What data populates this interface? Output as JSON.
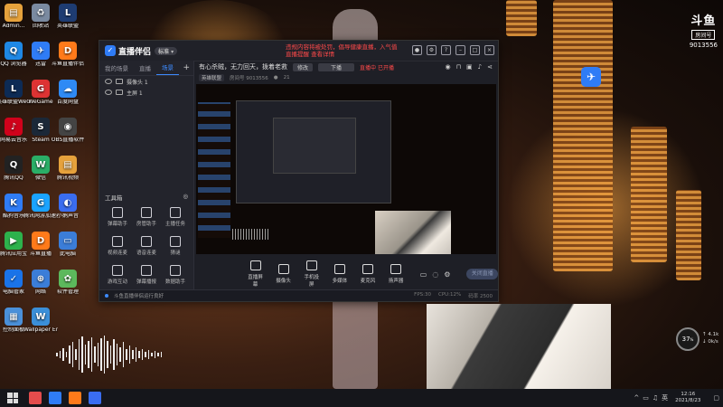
{
  "desktop_icons": [
    {
      "label": "Admin...",
      "name": "desktop-icon-admin",
      "icon": "folder-icon",
      "color": "#e6a23c",
      "glyph": "▤"
    },
    {
      "label": "回收站",
      "name": "desktop-icon-recycle-bin",
      "icon": "recycle-bin-icon",
      "color": "#7a8aa0",
      "glyph": "♻"
    },
    {
      "label": "英雄联盟",
      "name": "desktop-icon-lol",
      "icon": "game-icon",
      "color": "#1e3c72",
      "glyph": "L"
    },
    {
      "label": "QQ 浏览器",
      "name": "desktop-icon-qq-browser",
      "icon": "browser-icon",
      "color": "#1e88e5",
      "glyph": "Q"
    },
    {
      "label": "迅雷",
      "name": "desktop-icon-xunlei",
      "icon": "thunder-icon",
      "color": "#2f7cf6",
      "glyph": "✈"
    },
    {
      "label": "斗鱼直播伴侣",
      "name": "desktop-icon-douyu-assistant",
      "icon": "douyu-icon",
      "color": "#ff7a1a",
      "glyph": "D"
    },
    {
      "label": "英雄联盟WeGame版",
      "name": "desktop-icon-lol-wegame",
      "icon": "game-icon",
      "color": "#0d2b55",
      "glyph": "L"
    },
    {
      "label": "WeGame",
      "name": "desktop-icon-wegame",
      "icon": "wegame-icon",
      "color": "#d33",
      "glyph": "G"
    },
    {
      "label": "百度网盘",
      "name": "desktop-icon-baidu-pan",
      "icon": "cloud-icon",
      "color": "#2f8af5",
      "glyph": "☁"
    },
    {
      "label": "网易云音乐",
      "name": "desktop-icon-netease-music",
      "icon": "music-icon",
      "color": "#d0021b",
      "glyph": "♪"
    },
    {
      "label": "Steam",
      "name": "desktop-icon-steam",
      "icon": "steam-icon",
      "color": "#1b2838",
      "glyph": "S"
    },
    {
      "label": "OBS直播软件",
      "name": "desktop-icon-obs",
      "icon": "obs-icon",
      "color": "#444",
      "glyph": "◉"
    },
    {
      "label": "腾讯QQ",
      "name": "desktop-icon-qq",
      "icon": "qq-icon",
      "color": "#222",
      "glyph": "Q"
    },
    {
      "label": "微信",
      "name": "desktop-icon-wechat",
      "icon": "wechat-icon",
      "color": "#2aae67",
      "glyph": "W"
    },
    {
      "label": "腾讯视频",
      "name": "desktop-icon-tencent-video",
      "icon": "folder-icon",
      "color": "#e6a23c",
      "glyph": "▤"
    },
    {
      "label": "酷狗音乐",
      "name": "desktop-icon-kugou",
      "icon": "kugou-icon",
      "color": "#2f7cf6",
      "glyph": "K"
    },
    {
      "label": "腾讯网游加速器",
      "name": "desktop-icon-game-accelerator",
      "icon": "accelerator-icon",
      "color": "#1aa3ff",
      "glyph": "G"
    },
    {
      "label": "小鹅声音",
      "name": "desktop-icon-small-goose",
      "icon": "audio-icon",
      "color": "#3a6df0",
      "glyph": "◐"
    },
    {
      "label": "腾讯应用宝",
      "name": "desktop-icon-app-store",
      "icon": "app-store-icon",
      "color": "#2db24c",
      "glyph": "▶"
    },
    {
      "label": "斗鱼直播",
      "name": "desktop-icon-douyu",
      "icon": "douyu-icon",
      "color": "#ff7a1a",
      "glyph": "D"
    },
    {
      "label": "此电脑",
      "name": "desktop-icon-this-pc",
      "icon": "computer-icon",
      "color": "#3b7dd8",
      "glyph": "▭"
    },
    {
      "label": "电脑管家",
      "name": "desktop-icon-pc-manager",
      "icon": "shield-icon",
      "color": "#1a73e8",
      "glyph": "✓"
    },
    {
      "label": "网络",
      "name": "desktop-icon-network",
      "icon": "network-icon",
      "color": "#3b7dd8",
      "glyph": "⊕"
    },
    {
      "label": "软件管理",
      "name": "desktop-icon-software-manager",
      "icon": "software-icon",
      "color": "#5cb85c",
      "glyph": "✿"
    },
    {
      "label": "控制面板",
      "name": "desktop-icon-control-panel",
      "icon": "control-panel-icon",
      "color": "#4a90d9",
      "glyph": "▦"
    },
    {
      "label": "Wallpaper Engine",
      "name": "desktop-icon-wallpaper-engine",
      "icon": "wallpaper-icon",
      "color": "#3b8fd8",
      "glyph": "W"
    }
  ],
  "window": {
    "title": "直播伴侣",
    "version": "标准 ▾",
    "notice_line1": "违规内容将被处罚，倡导健康直播，入气值",
    "notice_line2": "直播提醒 查看详情",
    "left_tabs": [
      {
        "label": "我的场景",
        "active": false
      },
      {
        "label": "直播",
        "active": false
      },
      {
        "label": "场景",
        "active": true
      }
    ],
    "add_label": "+",
    "scenes": [
      {
        "label": "摄像头 1"
      },
      {
        "label": "主屏 1"
      }
    ],
    "tools_title": "工具箱",
    "tools": [
      {
        "label": "弹幕助手",
        "name": "tool-danmu"
      },
      {
        "label": "房管助手",
        "name": "tool-room-admin"
      },
      {
        "label": "主播任务",
        "name": "tool-tasks"
      },
      {
        "label": "视频连麦",
        "name": "tool-video-link"
      },
      {
        "label": "语音连麦",
        "name": "tool-voice-link"
      },
      {
        "label": "猜谜",
        "name": "tool-guess"
      },
      {
        "label": "游戏互动",
        "name": "tool-game-interact"
      },
      {
        "label": "弹幕播报",
        "name": "tool-danmu-broadcast"
      },
      {
        "label": "数据助手",
        "name": "tool-data-assistant"
      }
    ],
    "preview_title": "有心杀贼，无力回天，拨着老救",
    "edit_label": "修改",
    "download_label": "下播",
    "live_status": "直播中 已开播",
    "info_category": "英雄联盟",
    "info_room": "房间号 9013556",
    "info_viewers": "21",
    "bottom_tools": [
      {
        "label": "直播屏幕",
        "name": "bottom-screen-button"
      },
      {
        "label": "摄像头",
        "name": "bottom-camera-button"
      },
      {
        "label": "手机投屏",
        "name": "bottom-phone-button"
      },
      {
        "label": "多媒体",
        "name": "bottom-media-button"
      },
      {
        "label": "麦克风",
        "name": "bottom-mic-button"
      },
      {
        "label": "扬声器",
        "name": "bottom-speaker-button"
      }
    ],
    "go_live_label": "关闭直播",
    "status_text": "斗鱼直播伴侣运行良好",
    "status_right": [
      "FPS:30",
      "CPU:12%",
      "码率 2500"
    ]
  },
  "room_badge": {
    "brand": "斗鱼",
    "label": "房间号",
    "number": "9013556"
  },
  "speed_widget": {
    "percent": "37",
    "up": "↑ 4.1k",
    "down": "↓ 0k/s"
  },
  "clock": {
    "time": "12:16",
    "date": "2021/8/23"
  },
  "tray_label": "英"
}
